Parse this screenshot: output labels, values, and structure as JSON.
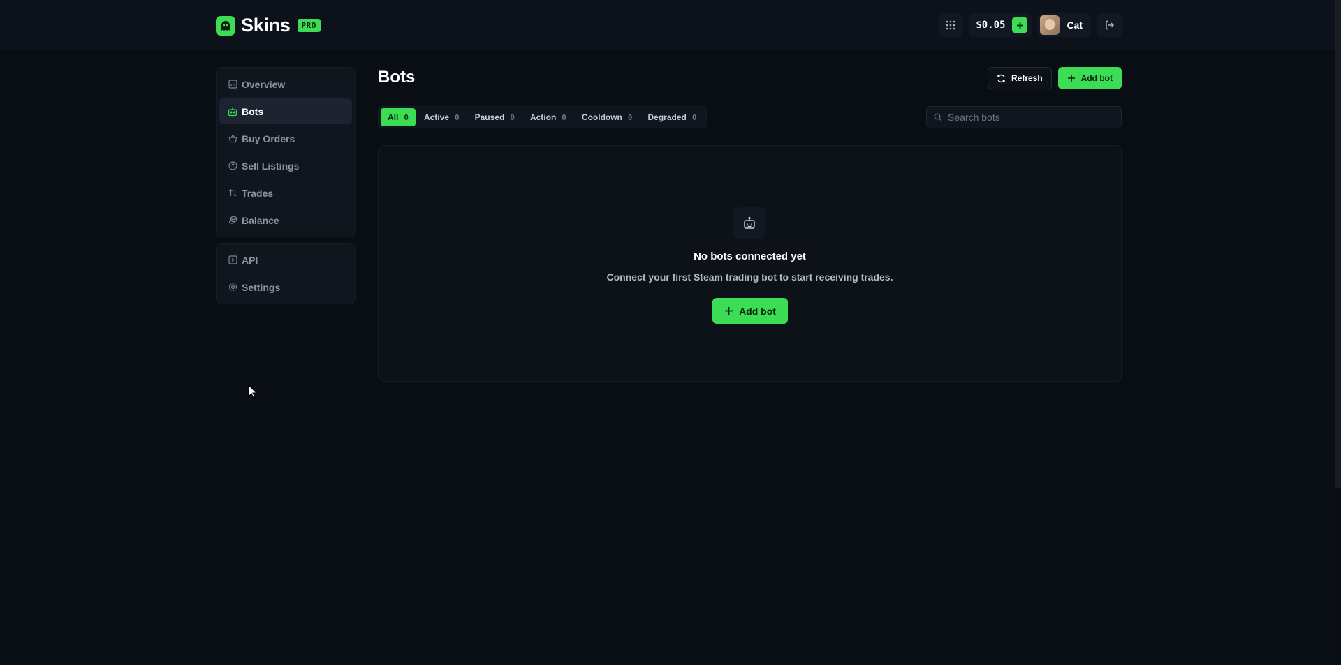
{
  "brand": {
    "name": "Skins",
    "badge": "PRO",
    "accent": "#3ddc55"
  },
  "header": {
    "balance": "$0.05",
    "username": "Cat",
    "icons": [
      "apps-grid-icon",
      "plus-icon",
      "logout-icon"
    ]
  },
  "sidebar": {
    "main": [
      {
        "label": "Overview",
        "icon": "chart-icon",
        "active": false
      },
      {
        "label": "Bots",
        "icon": "bot-icon",
        "active": true
      },
      {
        "label": "Buy Orders",
        "icon": "basket-icon",
        "active": false
      },
      {
        "label": "Sell Listings",
        "icon": "upload-icon",
        "active": false
      },
      {
        "label": "Trades",
        "icon": "swap-icon",
        "active": false
      },
      {
        "label": "Balance",
        "icon": "coins-icon",
        "active": false
      }
    ],
    "secondary": [
      {
        "label": "API",
        "icon": "code-icon",
        "active": false
      },
      {
        "label": "Settings",
        "icon": "gear-icon",
        "active": false
      }
    ]
  },
  "main": {
    "title": "Bots",
    "refresh_label": "Refresh",
    "add_bot_label": "Add bot",
    "tabs": [
      {
        "label": "All",
        "count": "0",
        "active": true
      },
      {
        "label": "Active",
        "count": "0",
        "active": false
      },
      {
        "label": "Paused",
        "count": "0",
        "active": false
      },
      {
        "label": "Action",
        "count": "0",
        "active": false
      },
      {
        "label": "Cooldown",
        "count": "0",
        "active": false
      },
      {
        "label": "Degraded",
        "count": "0",
        "active": false
      }
    ],
    "search_placeholder": "Search bots",
    "empty": {
      "title": "No bots connected yet",
      "subtitle": "Connect your first Steam trading bot to start receiving trades.",
      "button_label": "Add bot"
    }
  }
}
